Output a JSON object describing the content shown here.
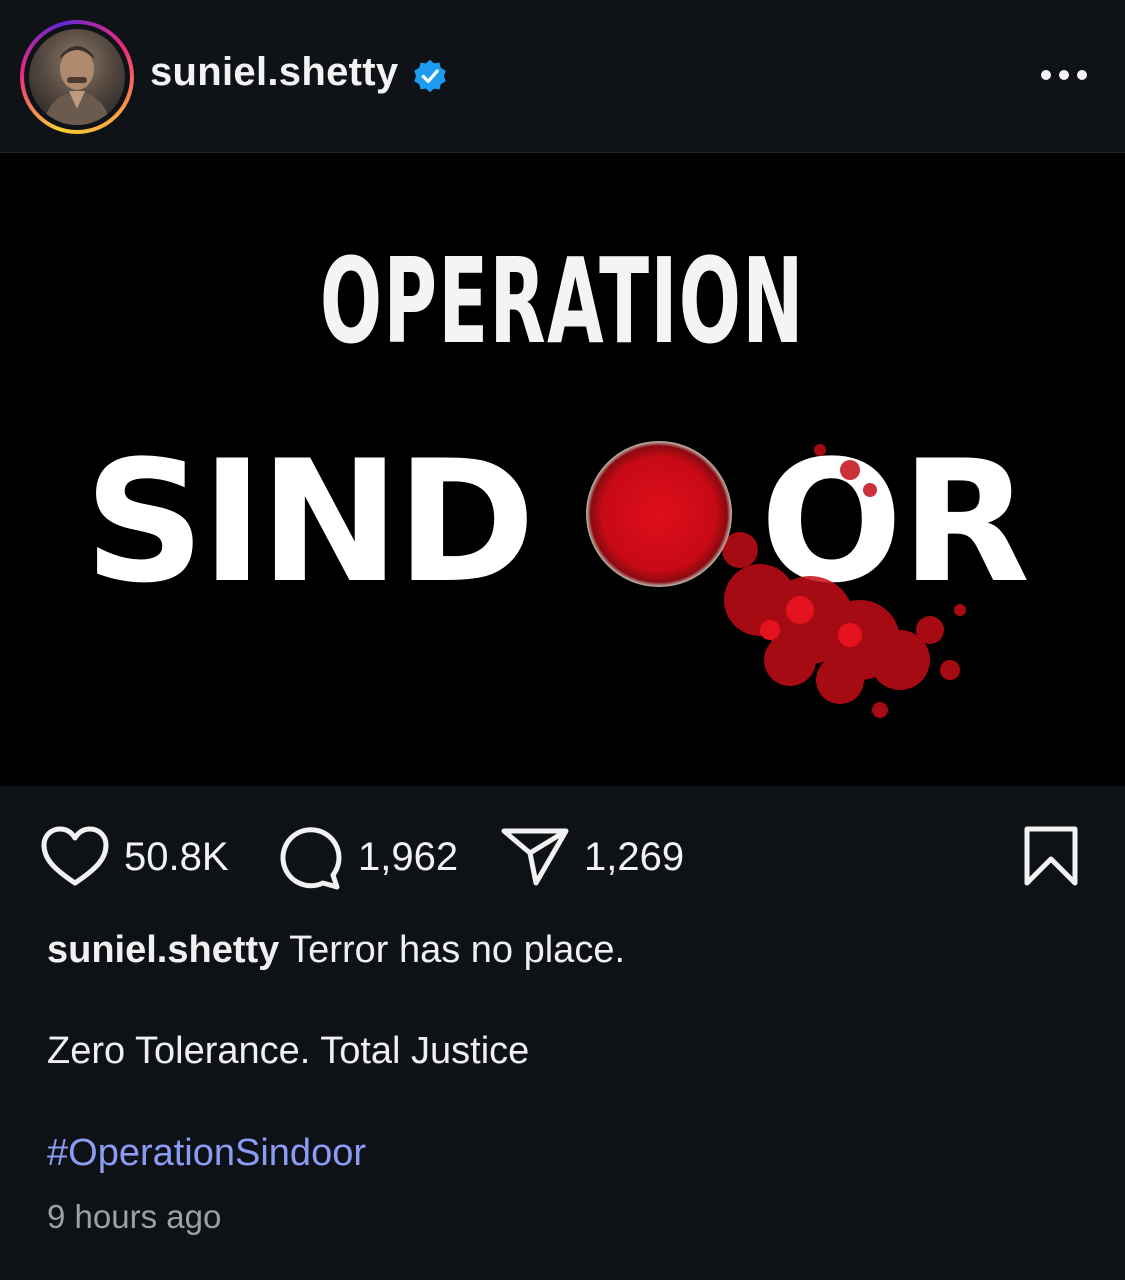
{
  "header": {
    "username": "suniel.shetty",
    "verified_icon": "verified-badge-icon",
    "more_icon": "more-options-icon"
  },
  "post_image": {
    "line1": "OPERATION",
    "line2_left": "SIND",
    "line2_right": "OR",
    "accent": "#d20c17"
  },
  "actions": {
    "likes": "50.8K",
    "comments": "1,962",
    "shares": "1,269",
    "icons": [
      "heart-icon",
      "comment-icon",
      "share-icon",
      "bookmark-icon"
    ]
  },
  "caption": {
    "username": "suniel.shetty",
    "text": "Terror has no place.",
    "line2": "Zero Tolerance. Total Justice",
    "hashtag": "#OperationSindoor",
    "timestamp": "9 hours ago"
  },
  "colors": {
    "background": "#0e1216",
    "hashtag": "#8c9cf5",
    "verified": "#1d9bf0"
  }
}
